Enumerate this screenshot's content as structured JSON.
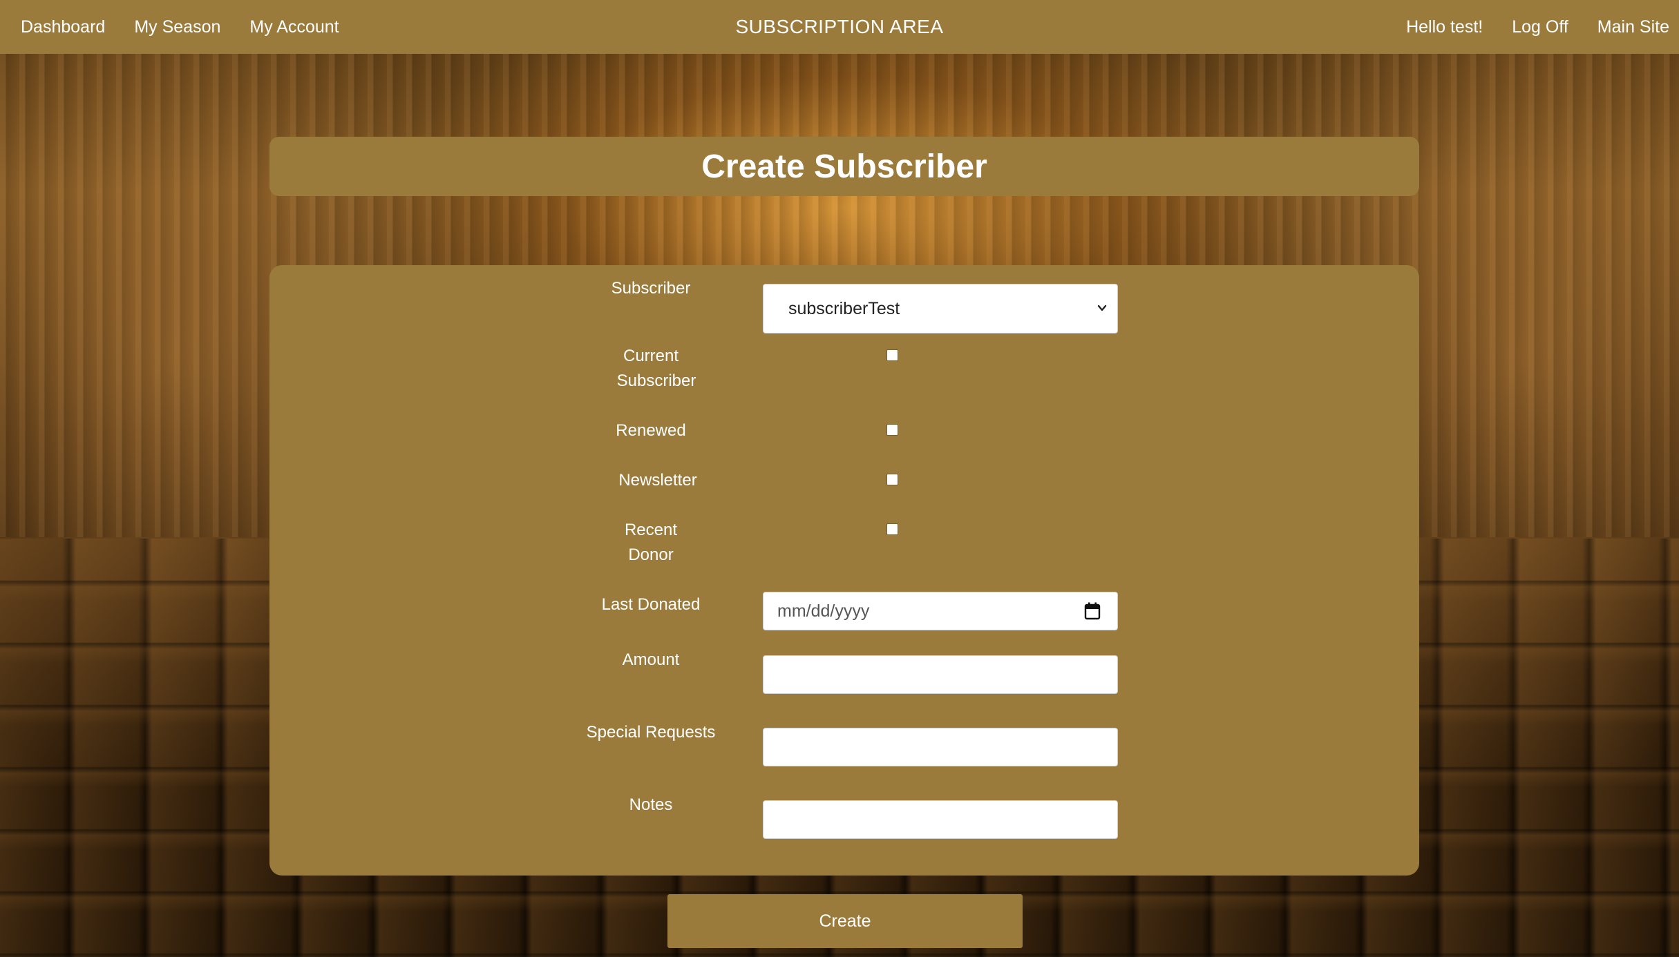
{
  "nav": {
    "left": [
      "Dashboard",
      "My Season",
      "My Account"
    ],
    "brand": "SUBSCRIPTION AREA",
    "greeting": "Hello test!",
    "log_off": "Log Off",
    "main_site": "Main Site"
  },
  "page": {
    "title": "Create Subscriber"
  },
  "form": {
    "subscriber_label": "Subscriber",
    "subscriber_value": "subscriberTest",
    "current_subscriber_label_1": "Current",
    "current_subscriber_label_2": "Subscriber",
    "current_subscriber_checked": false,
    "renewed_label": "Renewed",
    "renewed_checked": false,
    "newsletter_label": "Newsletter",
    "newsletter_checked": false,
    "recent_donor_label_1": "Recent",
    "recent_donor_label_2": "Donor",
    "recent_donor_checked": false,
    "last_donated_label": "Last Donated",
    "last_donated_placeholder": "mm/dd/yyyy",
    "amount_label": "Amount",
    "amount_value": "",
    "special_requests_label": "Special Requests",
    "special_requests_value": "",
    "notes_label": "Notes",
    "notes_value": ""
  },
  "actions": {
    "create_label": "Create"
  },
  "colors": {
    "panel": "#9b7b3b",
    "text": "#ffffff"
  },
  "icons": {
    "select_chevron": "chevron-down-icon",
    "date_picker": "calendar-icon"
  }
}
